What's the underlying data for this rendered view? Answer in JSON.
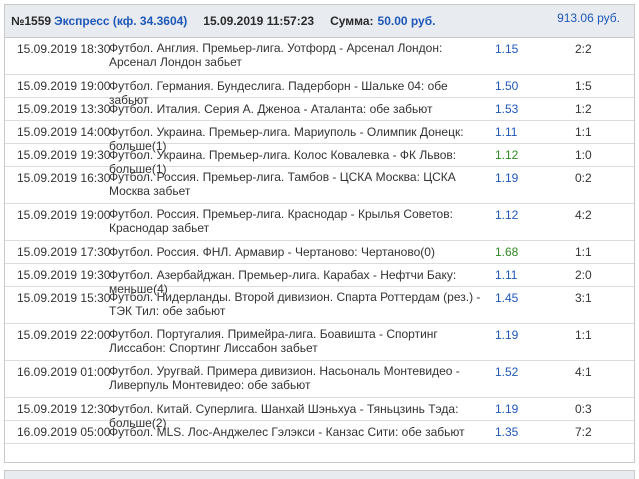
{
  "header": {
    "number": "№1559",
    "type": "Экспресс (кф. 34.3604)",
    "datetime": "15.09.2019 11:57:23",
    "sum_label": "Сумма:",
    "sum_value": "50.00 руб.",
    "win_value": "913.06 руб."
  },
  "colors": {
    "coef": "#1f57b8",
    "coef_won": "#2e8b22",
    "header_bg": "#e8ecf0"
  },
  "rows": [
    {
      "date": "15.09.2019 18:30",
      "event": "Футбол. Англия. Премьер-лига. Уотфорд - Арсенал Лондон: Арсенал Лондон забьет",
      "coef": "1.15",
      "score": "2:2",
      "won": false,
      "tall": true
    },
    {
      "date": "15.09.2019 19:00",
      "event": "Футбол. Германия. Бундеслига. Падерборн - Шальке 04: обе забьют",
      "coef": "1.50",
      "score": "1:5",
      "won": false,
      "tall": false
    },
    {
      "date": "15.09.2019 13:30",
      "event": "Футбол. Италия. Серия А. Дженоа - Аталанта: обе забьют",
      "coef": "1.53",
      "score": "1:2",
      "won": false,
      "tall": false
    },
    {
      "date": "15.09.2019 14:00",
      "event": "Футбол. Украина. Премьер-лига. Мариуполь - Олимпик Донецк: больше(1)",
      "coef": "1.11",
      "score": "1:1",
      "won": false,
      "tall": false
    },
    {
      "date": "15.09.2019 19:30",
      "event": "Футбол. Украина. Премьер-лига. Колос Ковалевка - ФК Львов: больше(1)",
      "coef": "1.12",
      "score": "1:0",
      "won": true,
      "tall": false
    },
    {
      "date": "15.09.2019 16:30",
      "event": "Футбол. Россия. Премьер-лига. Тамбов - ЦСКА Москва: ЦСКА Москва забьет",
      "coef": "1.19",
      "score": "0:2",
      "won": false,
      "tall": true
    },
    {
      "date": "15.09.2019 19:00",
      "event": "Футбол. Россия. Премьер-лига. Краснодар - Крылья Советов: Краснодар забьет",
      "coef": "1.12",
      "score": "4:2",
      "won": false,
      "tall": true
    },
    {
      "date": "15.09.2019 17:30",
      "event": "Футбол. Россия. ФНЛ. Армавир - Чертаново: Чертаново(0)",
      "coef": "1.68",
      "score": "1:1",
      "won": true,
      "tall": false
    },
    {
      "date": "15.09.2019 19:30",
      "event": "Футбол. Азербайджан. Премьер-лига. Карабах - Нефтчи Баку: меньше(4)",
      "coef": "1.11",
      "score": "2:0",
      "won": false,
      "tall": false
    },
    {
      "date": "15.09.2019 15:30",
      "event": "Футбол. Нидерланды. Второй дивизион. Спарта Роттердам (рез.) - ТЭК Тил: обе забьют",
      "coef": "1.45",
      "score": "3:1",
      "won": false,
      "tall": true
    },
    {
      "date": "15.09.2019 22:00",
      "event": "Футбол. Португалия. Примейра-лига. Боавишта - Спортинг Лиссабон: Спортинг Лиссабон забьет",
      "coef": "1.19",
      "score": "1:1",
      "won": false,
      "tall": true
    },
    {
      "date": "16.09.2019 01:00",
      "event": "Футбол. Уругвай. Примера дивизион. Насьональ Монтевидео - Ливерпуль Монтевидео: обе забьют",
      "coef": "1.52",
      "score": "4:1",
      "won": false,
      "tall": true
    },
    {
      "date": "15.09.2019 12:30",
      "event": "Футбол. Китай. Суперлига. Шанхай Шэньхуа - Тяньцзинь Тэда: больше(2)",
      "coef": "1.19",
      "score": "0:3",
      "won": false,
      "tall": false
    },
    {
      "date": "16.09.2019 05:00",
      "event": "Футбол. MLS. Лос-Анджелес Гэлэкси - Канзас Сити: обе забьют",
      "coef": "1.35",
      "score": "7:2",
      "won": false,
      "tall": false
    }
  ]
}
